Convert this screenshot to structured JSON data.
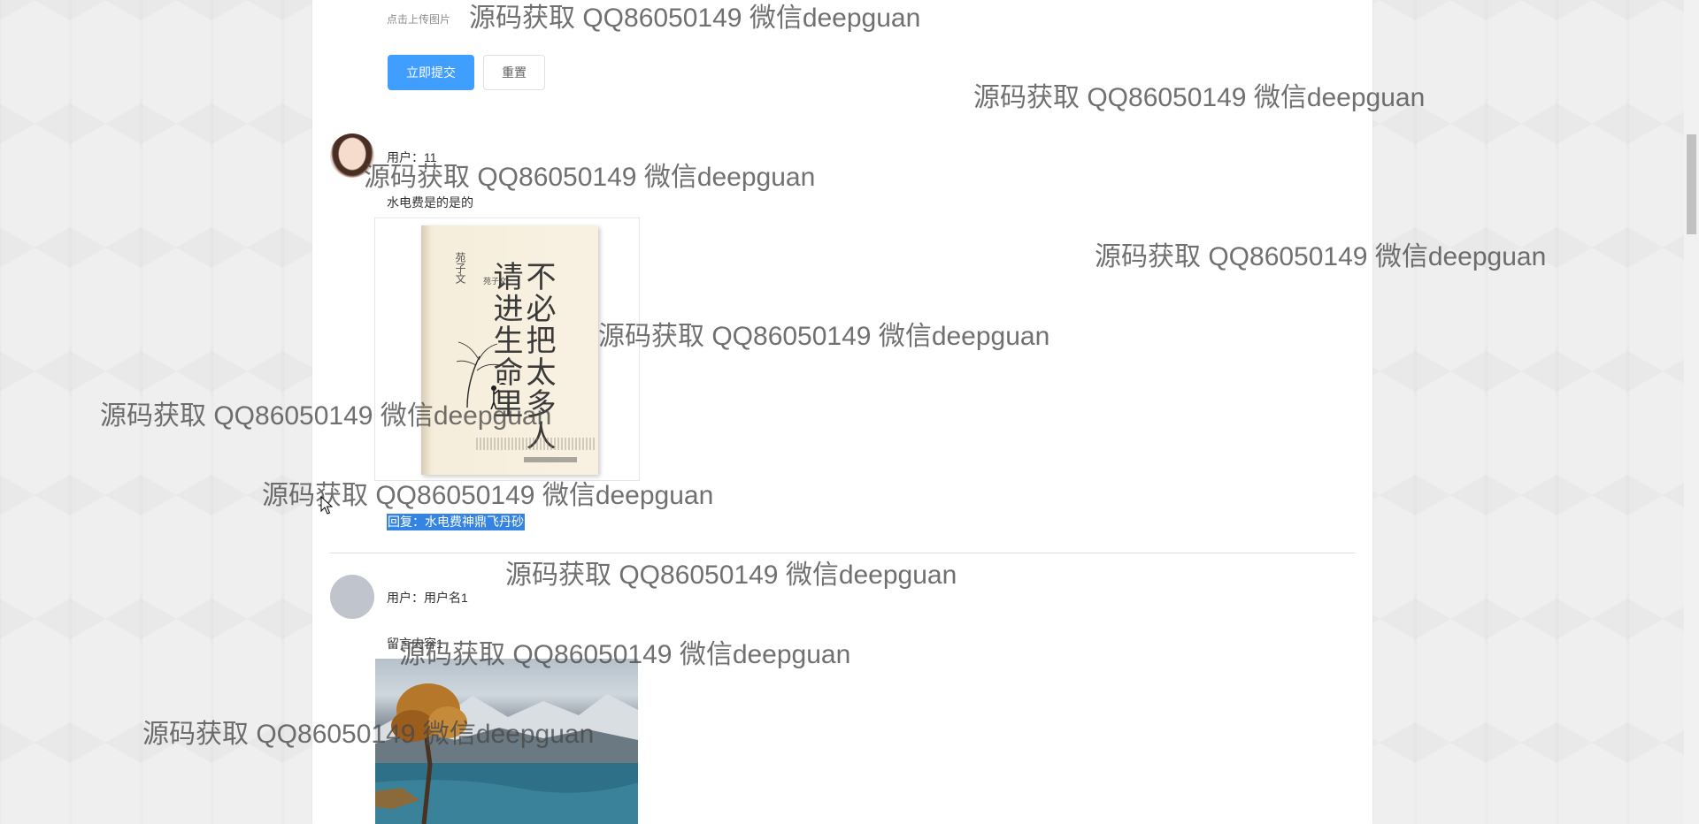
{
  "upload": {
    "hint": "点击上传图片"
  },
  "form": {
    "submit_label": "立即提交",
    "reset_label": "重置"
  },
  "comments": [
    {
      "user_line": "用户：11",
      "content": "水电费是的是的",
      "avatar": "user-photo",
      "image": {
        "kind": "book-cover",
        "title": "不必把太多人请进生命里",
        "author": "苑子文"
      },
      "reply": "回复：水电费神鼎飞丹砂"
    },
    {
      "user_line": "用户：用户名1",
      "content": "留言内容1",
      "avatar": "default-avatar",
      "image": {
        "kind": "landscape-photo"
      }
    }
  ],
  "watermark": "源码获取 QQ86050149 微信deepguan",
  "colors": {
    "primary": "#409eff",
    "reply_highlight": "#3584e4",
    "divider": "#dcdfe6"
  },
  "icons": [
    "mouse-cursor-icon"
  ]
}
